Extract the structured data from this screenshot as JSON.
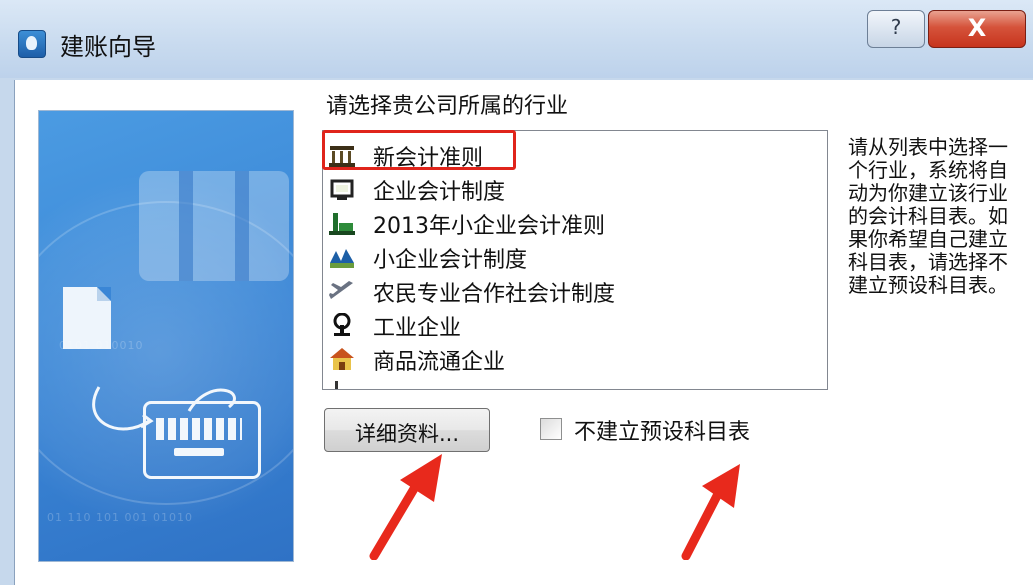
{
  "window": {
    "title": "建账向导",
    "help_glyph": "?",
    "close_glyph": "X"
  },
  "prompt": "请选择贵公司所属的行业",
  "industry_list": {
    "items": [
      {
        "label": "新会计准则",
        "icon": "building-icon",
        "selected": true
      },
      {
        "label": "企业会计制度",
        "icon": "tv-monitor-icon"
      },
      {
        "label": "2013年小企业会计准则",
        "icon": "factory-icon"
      },
      {
        "label": "小企业会计制度",
        "icon": "crops-icon"
      },
      {
        "label": "农民专业合作社会计制度",
        "icon": "airplane-icon"
      },
      {
        "label": "工业企业",
        "icon": "industry-icon"
      },
      {
        "label": "商品流通企业",
        "icon": "house-icon"
      },
      {
        "label": "",
        "icon": "partial-icon"
      }
    ],
    "scroll_up_glyph": "⌃",
    "scroll_down_glyph": "⌄"
  },
  "side_note": "请从列表中选择一个行业，系统将自动为你建立该行业的会计科目表。如果你希望自己建立科目表，请选择不建立预设科目表。",
  "detail_button": "详细资料...",
  "checkbox": {
    "label": "不建立预设科目表",
    "checked": false
  },
  "colors": {
    "highlight": "#e0241b",
    "arrow": "#e8291c",
    "illustration": "#3a86d6"
  },
  "illustration": {
    "binary_text_1": "0101 010010",
    "binary_text_2": "01 110 101 001 01010"
  }
}
